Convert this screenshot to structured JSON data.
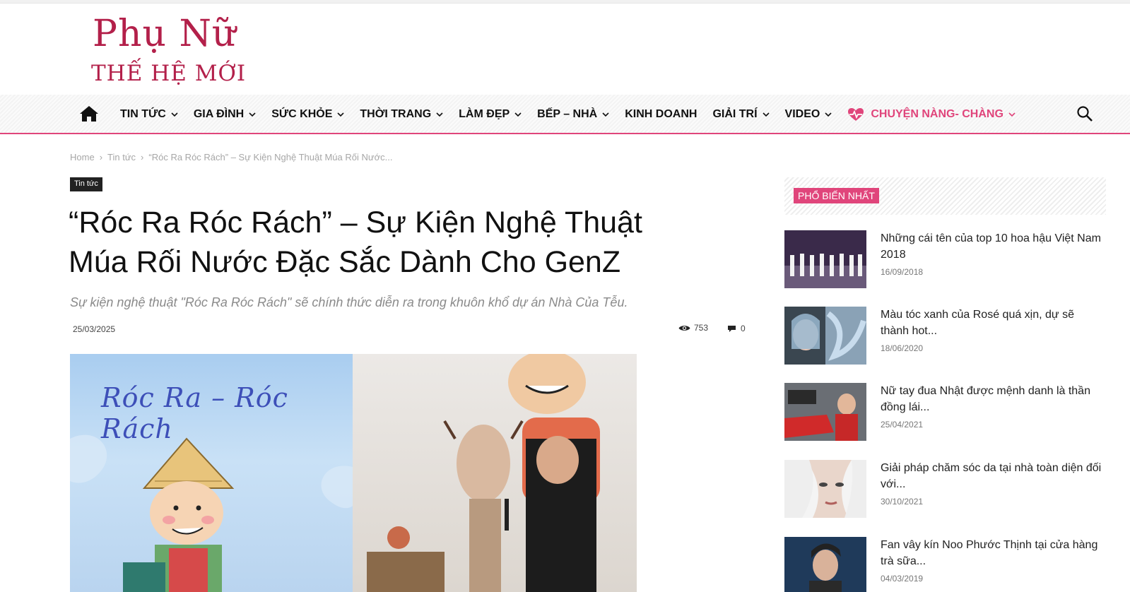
{
  "logo": {
    "line1": "Phụ Nữ",
    "line2": "THẾ HỆ MỚI"
  },
  "nav": {
    "items": [
      {
        "label": "TIN TỨC"
      },
      {
        "label": "GIA ĐÌNH"
      },
      {
        "label": "SỨC KHỎE"
      },
      {
        "label": "THỜI TRANG"
      },
      {
        "label": "LÀM ĐẸP"
      },
      {
        "label": "BẾP – NHÀ"
      },
      {
        "label": "KINH DOANH"
      },
      {
        "label": "GIẢI TRÍ"
      },
      {
        "label": "VIDEO"
      },
      {
        "label": "CHUYỆN NÀNG- CHÀNG"
      }
    ],
    "accent": "#e0457b"
  },
  "breadcrumb": [
    "Home",
    "Tin tức",
    "“Róc Ra Róc Rách” – Sự Kiện Nghệ Thuật Múa Rối Nước..."
  ],
  "article": {
    "category": "Tin tức",
    "title_line1": "“Róc Ra Róc Rách” – Sự Kiện Nghệ Thuật",
    "title_line2": "Múa Rối Nước Đặc Sắc Dành Cho GenZ",
    "subtitle": "Sự kiện nghệ thuật \"Róc Ra Róc Rách\" sẽ chính thức diễn ra trong khuôn khổ dự án Nhà Của Tễu.",
    "date": "25/03/2025",
    "views": "753",
    "comments": "0",
    "image_text": "Róc Ra – Róc Rách"
  },
  "sidebar": {
    "heading": "PHỔ BIẾN NHẤT",
    "items": [
      {
        "title_l1": "Những cái tên của top 10 hoa hậu Việt Nam",
        "title_l2": "2018",
        "date": "16/09/2018"
      },
      {
        "title_l1": "Màu tóc xanh của Rosé quá xịn, dự sẽ",
        "title_l2": "thành hot...",
        "date": "18/06/2020"
      },
      {
        "title_l1": "Nữ tay đua Nhật được mệnh danh là thần",
        "title_l2": "đồng lái...",
        "date": "25/04/2021"
      },
      {
        "title_l1": "Giải pháp chăm sóc da tại nhà toàn diện đối",
        "title_l2": "với...",
        "date": "30/10/2021"
      },
      {
        "title_l1": "Fan vây kín Noo Phước Thịnh tại cửa hàng",
        "title_l2": "trà sữa...",
        "date": "04/03/2019"
      }
    ]
  }
}
